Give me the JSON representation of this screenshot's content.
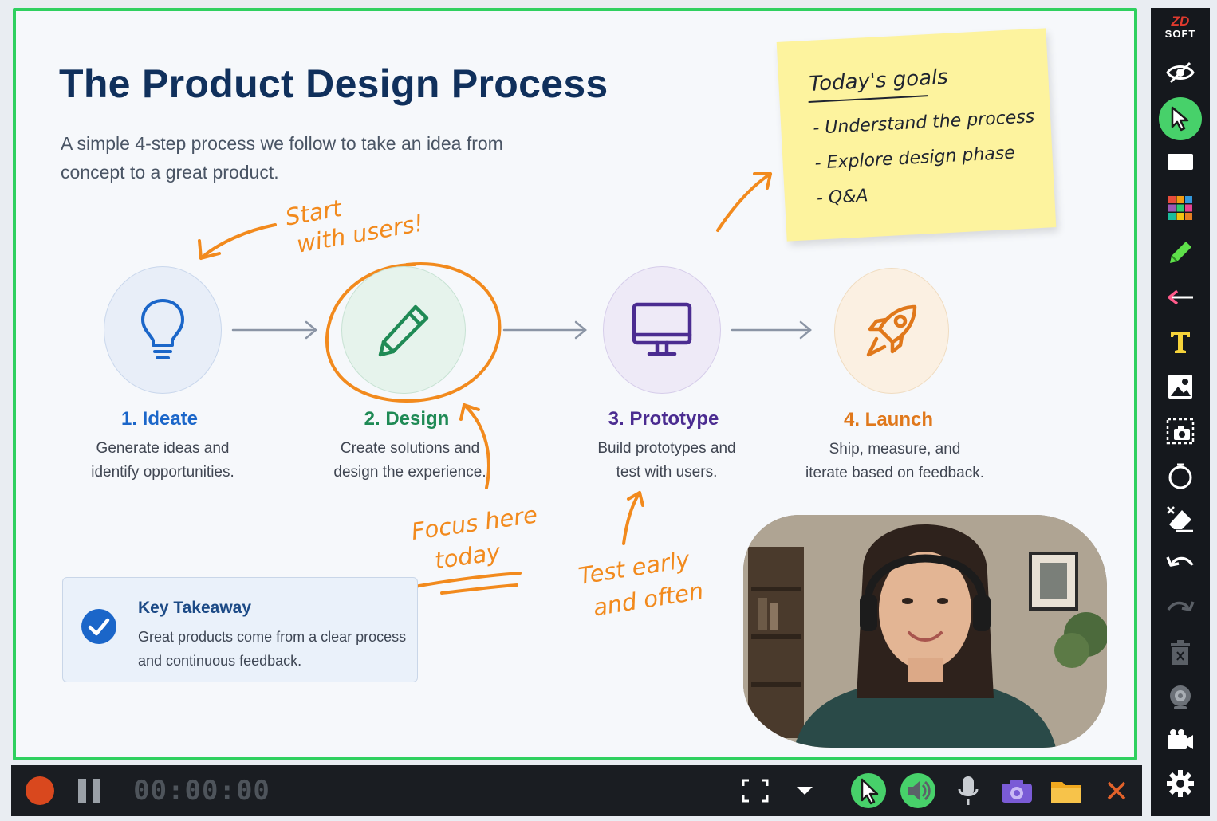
{
  "slide": {
    "title": "The Product Design Process",
    "subtitle": "A simple 4-step process we follow to take an idea from concept to a great product.",
    "steps": [
      {
        "title": "1. Ideate",
        "desc_line1": "Generate ideas and",
        "desc_line2": "identify opportunities.",
        "icon": "lightbulb-icon",
        "color": "#1b66c9"
      },
      {
        "title": "2. Design",
        "desc_line1": "Create solutions and",
        "desc_line2": "design the experience.",
        "icon": "pencil-icon",
        "color": "#1f8a55"
      },
      {
        "title": "3. Prototype",
        "desc_line1": "Build prototypes and",
        "desc_line2": "test with users.",
        "icon": "monitor-icon",
        "color": "#4b2c91"
      },
      {
        "title": "4. Launch",
        "desc_line1": "Ship, measure, and",
        "desc_line2": "iterate based on feedback.",
        "icon": "rocket-icon",
        "color": "#e0781b"
      }
    ],
    "takeaway": {
      "title": "Key Takeaway",
      "line1": "Great products come from a clear process",
      "line2": "and continuous feedback."
    }
  },
  "annotations": {
    "start_line1": "Start",
    "start_line2": "with users!",
    "focus_line1": "Focus here",
    "focus_line2": "today",
    "test_line1": "Test early",
    "test_line2": "and often",
    "accent": "#f28a1d"
  },
  "sticky_note": {
    "heading": "Today's goals",
    "items": [
      "- Understand the process",
      "- Explore design phase",
      "- Q&A"
    ]
  },
  "recorder": {
    "timer": "00:00:00",
    "logo_top": "ZD",
    "logo_bottom": "SOFT"
  },
  "colors": {
    "selection_border": "#2fd05f",
    "title": "#10305c",
    "toolbar_bg": "#15181d"
  }
}
